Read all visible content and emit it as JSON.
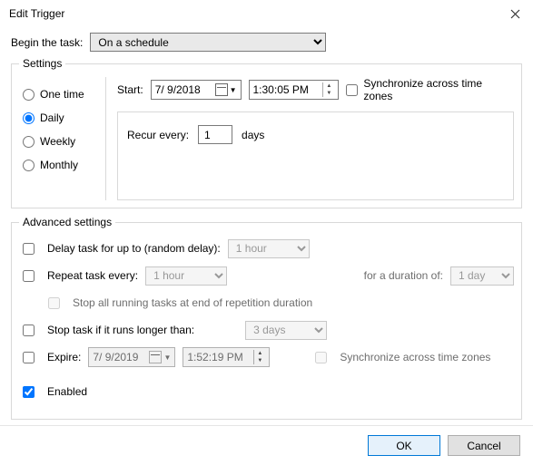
{
  "window": {
    "title": "Edit Trigger"
  },
  "begin": {
    "label": "Begin the task:",
    "value": "On a schedule"
  },
  "settings": {
    "legend": "Settings",
    "schedule": {
      "one_time": "One time",
      "daily": "Daily",
      "weekly": "Weekly",
      "monthly": "Monthly",
      "selected": "daily"
    },
    "start": {
      "label": "Start:",
      "date": "7/ 9/2018",
      "time": "1:30:05 PM",
      "sync_label": "Synchronize across time zones",
      "sync_checked": false
    },
    "recur": {
      "label": "Recur every:",
      "value": "1",
      "unit": "days"
    }
  },
  "advanced": {
    "legend": "Advanced settings",
    "delay": {
      "label": "Delay task for up to (random delay):",
      "checked": false,
      "value": "1 hour"
    },
    "repeat": {
      "label": "Repeat task every:",
      "checked": false,
      "value": "1 hour",
      "duration_label": "for a duration of:",
      "duration_value": "1 day",
      "stop_at_end_label": "Stop all running tasks at end of repetition duration",
      "stop_at_end_checked": false
    },
    "stop": {
      "label": "Stop task if it runs longer than:",
      "checked": false,
      "value": "3 days"
    },
    "expire": {
      "label": "Expire:",
      "checked": false,
      "date": "7/ 9/2019",
      "time": "1:52:19 PM",
      "sync_label": "Synchronize across time zones",
      "sync_checked": false
    },
    "enabled": {
      "label": "Enabled",
      "checked": true
    }
  },
  "buttons": {
    "ok": "OK",
    "cancel": "Cancel"
  }
}
